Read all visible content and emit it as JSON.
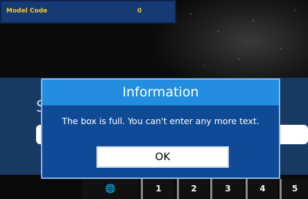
{
  "info_panel": {
    "model_code_label": "Model Code",
    "model_code_value": "0"
  },
  "background": {
    "partial_glyph": "S"
  },
  "dialog": {
    "title": "Information",
    "message": "The box is full. You can't enter any more text.",
    "ok_label": "OK"
  },
  "keyboard": {
    "keys": [
      {
        "name": "globe-icon",
        "label": "🌐"
      },
      {
        "name": "key-1",
        "label": "1"
      },
      {
        "name": "key-2",
        "label": "2"
      },
      {
        "name": "key-3",
        "label": "3"
      },
      {
        "name": "key-4",
        "label": "4"
      },
      {
        "name": "key-5",
        "label": "5"
      }
    ]
  },
  "colors": {
    "dialog_header": "#238ee0",
    "dialog_body": "#0f4a96",
    "panel_text": "#f6c630",
    "band": "#173a63"
  }
}
